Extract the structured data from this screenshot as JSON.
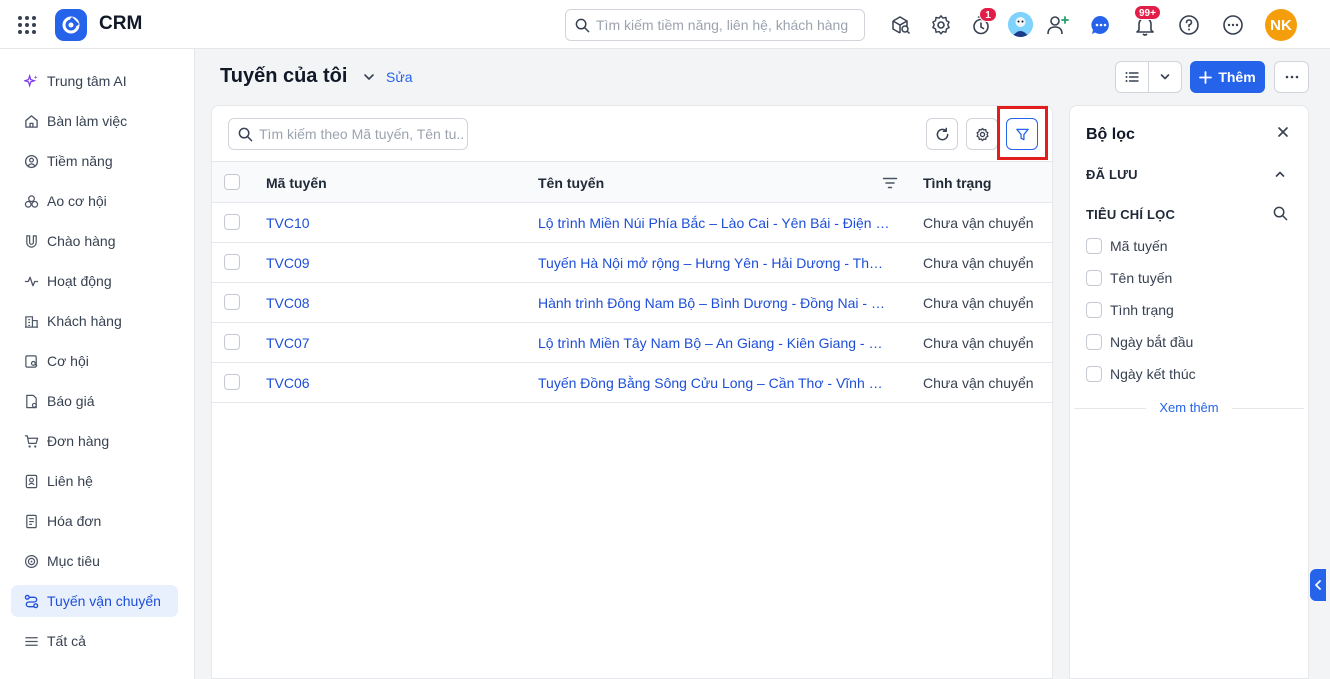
{
  "app": {
    "name": "CRM"
  },
  "global_search": {
    "placeholder": "Tìm kiếm tiềm năng, liên hệ, khách hàng"
  },
  "header_icons": {
    "timer_badge": "1",
    "notification_badge": "99+",
    "user_initials": "NK"
  },
  "sidebar": {
    "items": [
      {
        "label": "Trung tâm AI",
        "icon": "sparkle-icon"
      },
      {
        "label": "Bàn làm việc",
        "icon": "home-icon"
      },
      {
        "label": "Tiềm năng",
        "icon": "potential-icon"
      },
      {
        "label": "Ao cơ hội",
        "icon": "pool-icon"
      },
      {
        "label": "Chào hàng",
        "icon": "magnet-icon"
      },
      {
        "label": "Hoạt động",
        "icon": "activity-icon"
      },
      {
        "label": "Khách hàng",
        "icon": "building-icon"
      },
      {
        "label": "Cơ hội",
        "icon": "opportunity-icon"
      },
      {
        "label": "Báo giá",
        "icon": "quote-icon"
      },
      {
        "label": "Đơn hàng",
        "icon": "cart-icon"
      },
      {
        "label": "Liên hệ",
        "icon": "contact-icon"
      },
      {
        "label": "Hóa đơn",
        "icon": "invoice-icon"
      },
      {
        "label": "Mục tiêu",
        "icon": "target-icon"
      },
      {
        "label": "Tuyến vận chuyển",
        "icon": "route-icon",
        "active": true
      },
      {
        "label": "Tất cả",
        "icon": "menu-icon"
      }
    ]
  },
  "page": {
    "title": "Tuyến của tôi",
    "edit_label": "Sửa",
    "add_label": "Thêm"
  },
  "table": {
    "search_placeholder": "Tìm kiếm theo Mã tuyến, Tên tu...",
    "columns": [
      "Mã tuyến",
      "Tên tuyến",
      "Tình trạng"
    ],
    "rows": [
      {
        "code": "TVC10",
        "name": "Lộ trình Miền Núi Phía Bắc – Lào Cai - Yên Bái - Điện Bi...",
        "status": "Chưa vận chuyển"
      },
      {
        "code": "TVC09",
        "name": "Tuyến Hà Nội mở rộng – Hưng Yên - Hải Dương - Thái ...",
        "status": "Chưa vận chuyển"
      },
      {
        "code": "TVC08",
        "name": "Hành trình Đông Nam Bộ – Bình Dương - Đồng Nai - Bà...",
        "status": "Chưa vận chuyển"
      },
      {
        "code": "TVC07",
        "name": "Lộ trình Miền Tây Nam Bộ – An Giang - Kiên Giang - Cà...",
        "status": "Chưa vận chuyển"
      },
      {
        "code": "TVC06",
        "name": "Tuyến Đồng Bằng Sông Cửu Long – Cần Thơ - Vĩnh Lo...",
        "status": "Chưa vận chuyển"
      }
    ]
  },
  "filter_panel": {
    "title": "Bộ lọc",
    "saved_label": "ĐÃ LƯU",
    "criteria_label": "TIÊU CHÍ LỌC",
    "criteria": [
      "Mã tuyến",
      "Tên tuyến",
      "Tình trạng",
      "Ngày bắt đầu",
      "Ngày kết thúc"
    ],
    "see_more": "Xem thêm"
  },
  "colors": {
    "accent": "#2563eb",
    "highlight": "#e11d1d",
    "active_bg": "#e8effd"
  }
}
